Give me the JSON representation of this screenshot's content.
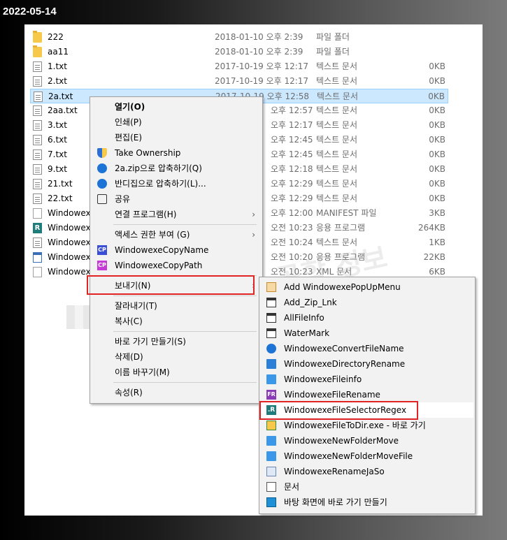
{
  "date_label": "2022-05-14",
  "files": [
    {
      "name": "222",
      "date": "2018-01-10 오후 2:39",
      "type": "파일 폴더",
      "size": "",
      "icon": "folder"
    },
    {
      "name": "aa11",
      "date": "2018-01-10 오후 2:39",
      "type": "파일 폴더",
      "size": "",
      "icon": "folder"
    },
    {
      "name": "1.txt",
      "date": "2017-10-19 오후 12:17",
      "type": "텍스트 문서",
      "size": "0KB",
      "icon": "doc"
    },
    {
      "name": "2.txt",
      "date": "2017-10-19 오후 12:17",
      "type": "텍스트 문서",
      "size": "0KB",
      "icon": "doc"
    },
    {
      "name": "2a.txt",
      "date": "2017-10-19 오후 12:58",
      "type": "텍스트 문서",
      "size": "0KB",
      "icon": "doc",
      "selected": true
    },
    {
      "name": "2aa.txt",
      "date": "오후 12:57",
      "type": "텍스트 문서",
      "size": "0KB",
      "icon": "doc"
    },
    {
      "name": "3.txt",
      "date": "오후 12:17",
      "type": "텍스트 문서",
      "size": "0KB",
      "icon": "doc"
    },
    {
      "name": "6.txt",
      "date": "오후 12:45",
      "type": "텍스트 문서",
      "size": "0KB",
      "icon": "doc"
    },
    {
      "name": "7.txt",
      "date": "오후 12:45",
      "type": "텍스트 문서",
      "size": "0KB",
      "icon": "doc"
    },
    {
      "name": "9.txt",
      "date": "오후 12:18",
      "type": "텍스트 문서",
      "size": "0KB",
      "icon": "doc"
    },
    {
      "name": "21.txt",
      "date": "오후 12:29",
      "type": "텍스트 문서",
      "size": "0KB",
      "icon": "doc"
    },
    {
      "name": "22.txt",
      "date": "오후 12:29",
      "type": "텍스트 문서",
      "size": "0KB",
      "icon": "doc"
    },
    {
      "name": "Windowexe",
      "date": "오후 12:00",
      "type": "MANIFEST 파일",
      "size": "3KB",
      "icon": "blank"
    },
    {
      "name": "Windowexe",
      "date": "오전 10:23",
      "type": "응용 프로그램",
      "size": "264KB",
      "icon": "r"
    },
    {
      "name": "Windowexe",
      "date": "오전 10:24",
      "type": "텍스트 문서",
      "size": "1KB",
      "icon": "doc"
    },
    {
      "name": "Windowexe",
      "date": "오전 10:20",
      "type": "응용 프로그램",
      "size": "22KB",
      "icon": "win"
    },
    {
      "name": "Windowexe",
      "date": "오전 10:23",
      "type": "XML 문서",
      "size": "6KB",
      "icon": "blank"
    }
  ],
  "watermark": "컴퓨터 공학 정보",
  "context_menu": {
    "items": [
      {
        "label": "열기(O)",
        "bold": true
      },
      {
        "label": "인쇄(P)"
      },
      {
        "label": "편집(E)"
      },
      {
        "label": "Take Ownership",
        "icon": "shield"
      },
      {
        "label": "2a.zip으로 압축하기(Q)",
        "icon": "circle"
      },
      {
        "label": "반디집으로 압축하기(L)...",
        "icon": "circle"
      },
      {
        "label": "공유",
        "icon": "share"
      },
      {
        "label": "연결 프로그램(H)",
        "submenu": true
      },
      {
        "label": "액세스 권한 부여 (G)",
        "submenu": true
      },
      {
        "label": "WindowexeCopyName",
        "icon": "cp"
      },
      {
        "label": "WindowexeCopyPath",
        "icon": "cp2"
      },
      {
        "label": "보내기(N)",
        "submenu": true,
        "highlighted": true
      },
      {
        "label": "잘라내기(T)"
      },
      {
        "label": "복사(C)"
      },
      {
        "label": "바로 가기 만들기(S)"
      },
      {
        "label": "삭제(D)"
      },
      {
        "label": "이름 바꾸기(M)"
      },
      {
        "label": "속성(R)"
      }
    ],
    "icon_text_cp": "CP"
  },
  "sendto_menu": {
    "items": [
      {
        "label": "Add WindowexePopUpMenu",
        "icon": "orange"
      },
      {
        "label": "Add_Zip_Lnk",
        "icon": "box"
      },
      {
        "label": "AllFileInfo",
        "icon": "box"
      },
      {
        "label": "WaterMark",
        "icon": "box"
      },
      {
        "label": "WindowexeConvertFileName",
        "icon": "info"
      },
      {
        "label": "WindowexeDirectoryRename",
        "icon": "fold"
      },
      {
        "label": "WindowexeFileinfo",
        "icon": "blue"
      },
      {
        "label": "WindowexeFileRename",
        "icon": "fr"
      },
      {
        "label": "WindowexeFileSelectorRegex",
        "icon": "r",
        "highlighted": true
      },
      {
        "label": "WindowexeFileToDir.exe - 바로 가기",
        "icon": "dir"
      },
      {
        "label": "WindowexeNewFolderMove",
        "icon": "blue"
      },
      {
        "label": "WindowexeNewFolderMoveFile",
        "icon": "blue"
      },
      {
        "label": "WindowexeRenameJaSo",
        "icon": "jaso"
      },
      {
        "label": "문서",
        "icon": "doc"
      },
      {
        "label": "바탕 화면에 바로 가기 만들기",
        "icon": "desk"
      }
    ],
    "icon_text_fr": "FR",
    "icon_text_r": ".R"
  }
}
